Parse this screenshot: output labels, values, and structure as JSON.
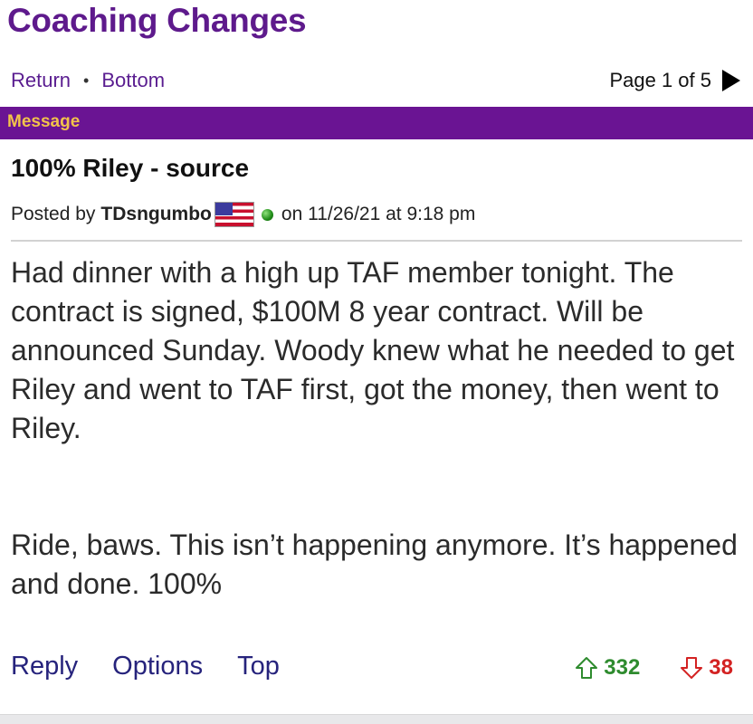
{
  "board": {
    "title": "Coaching Changes"
  },
  "nav": {
    "return_label": "Return",
    "bottom_label": "Bottom",
    "page_label": "Page 1 of 5"
  },
  "message_bar": {
    "label": "Message"
  },
  "post": {
    "title": "100% Riley - source",
    "posted_by_prefix": "Posted by",
    "author": "TDsngumbo",
    "date_text": "on 11/26/21 at 9:18 pm",
    "paragraphs": [
      "Had dinner with a high up TAF member tonight. The contract is signed, $100M 8 year contract. Will be announced Sunday. Woody knew what he needed to get Riley and went to TAF first, got the money, then went to Riley.",
      "Ride, baws. This isn’t happening anymore. It’s happened and done. 100%"
    ]
  },
  "actions": {
    "reply": "Reply",
    "options": "Options",
    "top": "Top"
  },
  "votes": {
    "up": "332",
    "down": "38"
  },
  "colors": {
    "brand_purple": "#6a1493",
    "bar_text_gold": "#f2c34a",
    "upvote_green": "#2e8b2e",
    "downvote_red": "#d32222"
  },
  "icons": {
    "next_page": "triangle-right-icon",
    "flag": "us-flag-icon",
    "status": "online-dot-icon",
    "upvote": "arrow-up-icon",
    "downvote": "arrow-down-icon"
  }
}
